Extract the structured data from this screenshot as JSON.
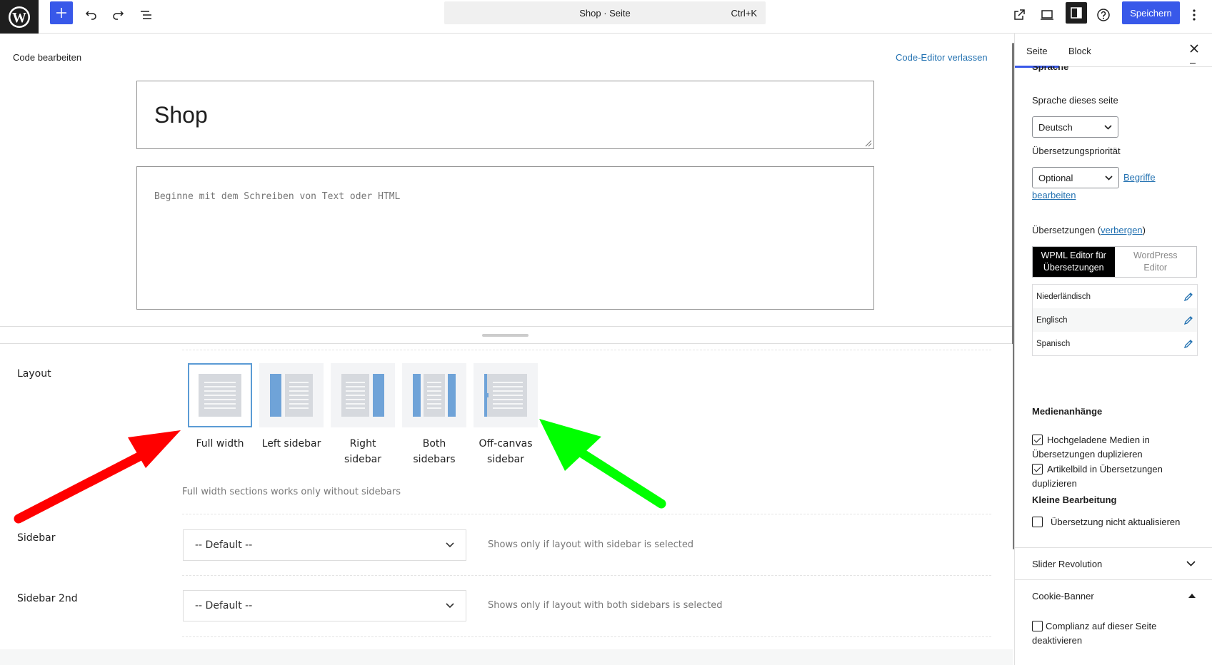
{
  "topbar": {
    "command_title": "Shop · Seite",
    "command_shortcut": "Ctrl+K",
    "save_label": "Speichern"
  },
  "editor": {
    "code_title": "Code bearbeiten",
    "exit_code_label": "Code-Editor verlassen",
    "post_title": "Shop",
    "content_placeholder": "Beginne mit dem Schreiben von Text oder HTML"
  },
  "meta": {
    "layout_label": "Layout",
    "layout_options": [
      {
        "line1": "Full width",
        "line2": "",
        "selected": true
      },
      {
        "line1": "Left sidebar",
        "line2": "",
        "selected": false
      },
      {
        "line1": "Right",
        "line2": "sidebar",
        "selected": false
      },
      {
        "line1": "Both",
        "line2": "sidebars",
        "selected": false
      },
      {
        "line1": "Off-canvas",
        "line2": "sidebar",
        "selected": false
      }
    ],
    "layout_help": "Full width sections works only without sidebars",
    "sidebar_label": "Sidebar",
    "sidebar_value": "-- Default --",
    "sidebar_hint": "Shows only if layout with sidebar is selected",
    "sidebar2_label": "Sidebar 2nd",
    "sidebar2_value": "-- Default --",
    "sidebar2_hint": "Shows only if layout with both sidebars is selected"
  },
  "sidebar": {
    "tabs": [
      "Seite",
      "Block"
    ],
    "section_partial": "Sprache",
    "page_language_label": "Sprache dieses seite",
    "page_language_value": "Deutsch",
    "priority_label": "Übersetzungspriorität",
    "priority_value": "Optional",
    "terms_link_1": "Begriffe",
    "terms_link_2": "bearbeiten",
    "translations_label": "Übersetzungen (",
    "translations_hide": "verbergen",
    "translations_close": ")",
    "wpml_on_1": "WPML Editor für",
    "wpml_on_2": "Übersetzungen",
    "wpml_off_1": "WordPress",
    "wpml_off_2": "Editor",
    "languages": [
      "Niederländisch",
      "Englisch",
      "Spanisch"
    ],
    "media_label": "Medienanhänge",
    "media_opt1_a": "Hochgeladene Medien in",
    "media_opt1_b": "Übersetzungen duplizieren",
    "media_opt2_a": "Artikelbild in Übersetzungen",
    "media_opt2_b": "duplizieren",
    "minor_label": "Kleine Bearbeitung",
    "minor_opt": "Übersetzung nicht aktualisieren",
    "slider_panel": "Slider Revolution",
    "cookie_panel": "Cookie-Banner",
    "cookie_opt_a": "Complianz auf dieser Seite",
    "cookie_opt_b": "deaktivieren"
  },
  "colors": {
    "accent": "#3858e9",
    "link": "#2271b1",
    "selected_border": "#5b9bd5",
    "arrow_red": "#ff0000",
    "arrow_green": "#00ff00"
  }
}
